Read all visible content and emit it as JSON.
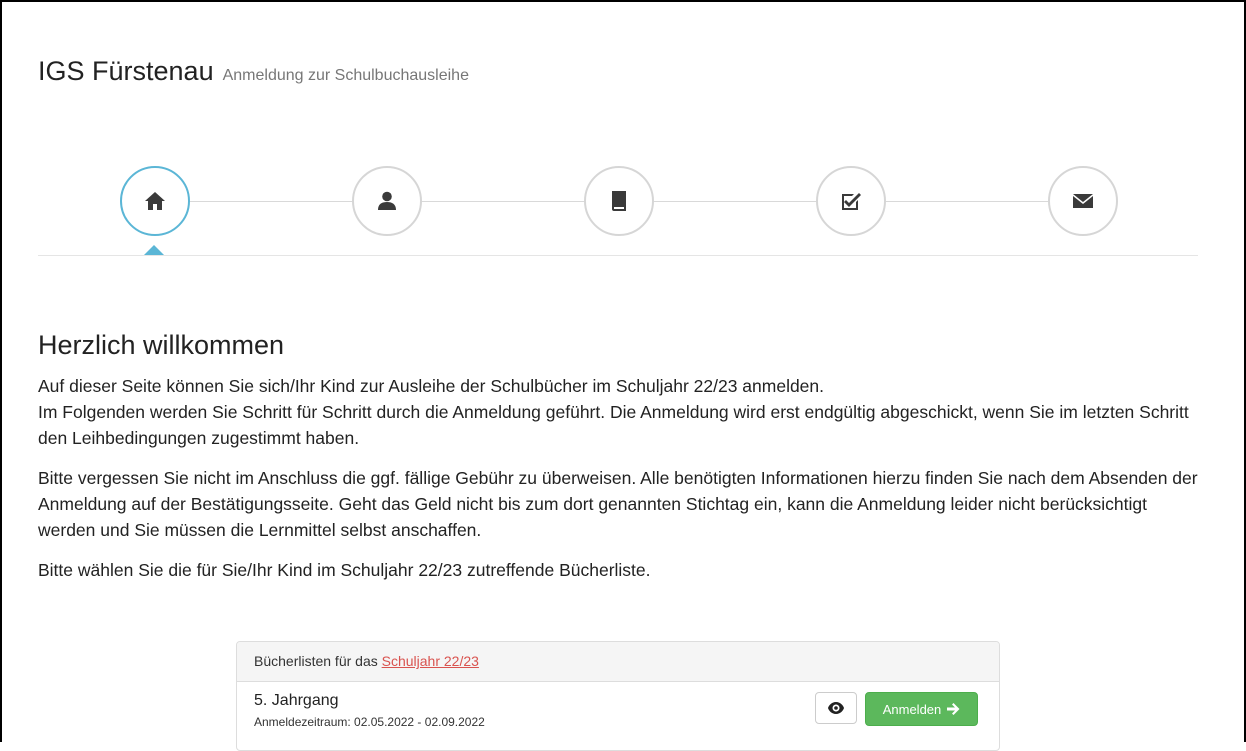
{
  "header": {
    "brand": "IGS Fürstenau",
    "subtitle": "Anmeldung zur Schulbuchausleihe"
  },
  "wizard": {
    "steps": [
      {
        "icon": "home-icon",
        "active": true
      },
      {
        "icon": "user-icon",
        "active": false
      },
      {
        "icon": "book-icon",
        "active": false
      },
      {
        "icon": "checkbox-icon",
        "active": false
      },
      {
        "icon": "envelope-icon",
        "active": false
      }
    ],
    "accent": "#5bb6d6"
  },
  "content": {
    "heading": "Herzlich willkommen",
    "paragraph1": "Auf dieser Seite können Sie sich/Ihr Kind zur Ausleihe der Schulbücher im Schuljahr 22/23 anmelden.",
    "paragraph1b": "Im Folgenden werden Sie Schritt für Schritt durch die Anmeldung geführt. Die Anmeldung wird erst endgültig abgeschickt, wenn Sie im letzten Schritt den Leihbedingungen zugestimmt haben.",
    "paragraph2": "Bitte vergessen Sie nicht im Anschluss die ggf. fällige Gebühr zu überweisen. Alle benötigten Informationen hierzu finden Sie nach dem Absenden der Anmeldung auf der Bestätigungsseite. Geht das Geld nicht bis zum dort genannten Stichtag ein, kann die Anmeldung leider nicht berücksichtigt werden und Sie müssen die Lernmittel selbst anschaffen.",
    "paragraph3": "Bitte wählen Sie die für Sie/Ihr Kind im Schuljahr 22/23 zutreffende Bücherliste."
  },
  "panel": {
    "heading_prefix": "Bücherlisten für das",
    "heading_link": "Schuljahr 22/23",
    "rows": [
      {
        "title": "5. Jahrgang",
        "meta": "Anmeldezeitraum: 02.05.2022 - 02.09.2022",
        "register_label": "Anmelden"
      }
    ]
  },
  "colors": {
    "link": "#d9534f",
    "success": "#5cb85c"
  }
}
